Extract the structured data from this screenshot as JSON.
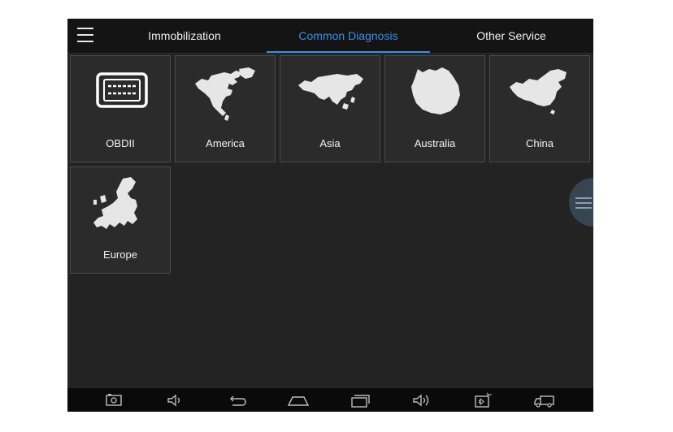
{
  "tabs": [
    {
      "label": "Immobilization",
      "active": false
    },
    {
      "label": "Common Diagnosis",
      "active": true
    },
    {
      "label": "Other Service",
      "active": false
    }
  ],
  "tiles": [
    {
      "label": "OBDII",
      "icon": "obd-connector-icon"
    },
    {
      "label": "America",
      "icon": "america-map-icon"
    },
    {
      "label": "Asia",
      "icon": "asia-map-icon"
    },
    {
      "label": "Australia",
      "icon": "australia-map-icon"
    },
    {
      "label": "China",
      "icon": "china-map-icon"
    },
    {
      "label": "Europe",
      "icon": "europe-map-icon"
    }
  ],
  "navbar": [
    "screenshot-icon",
    "volume-down-icon",
    "back-icon",
    "home-icon",
    "recent-apps-icon",
    "volume-up-icon",
    "bluetooth-vci-icon",
    "truck-icon"
  ],
  "colors": {
    "accent": "#3a8ee6",
    "background": "#232323",
    "tile": "#2b2b2b",
    "topbar": "#141414"
  }
}
